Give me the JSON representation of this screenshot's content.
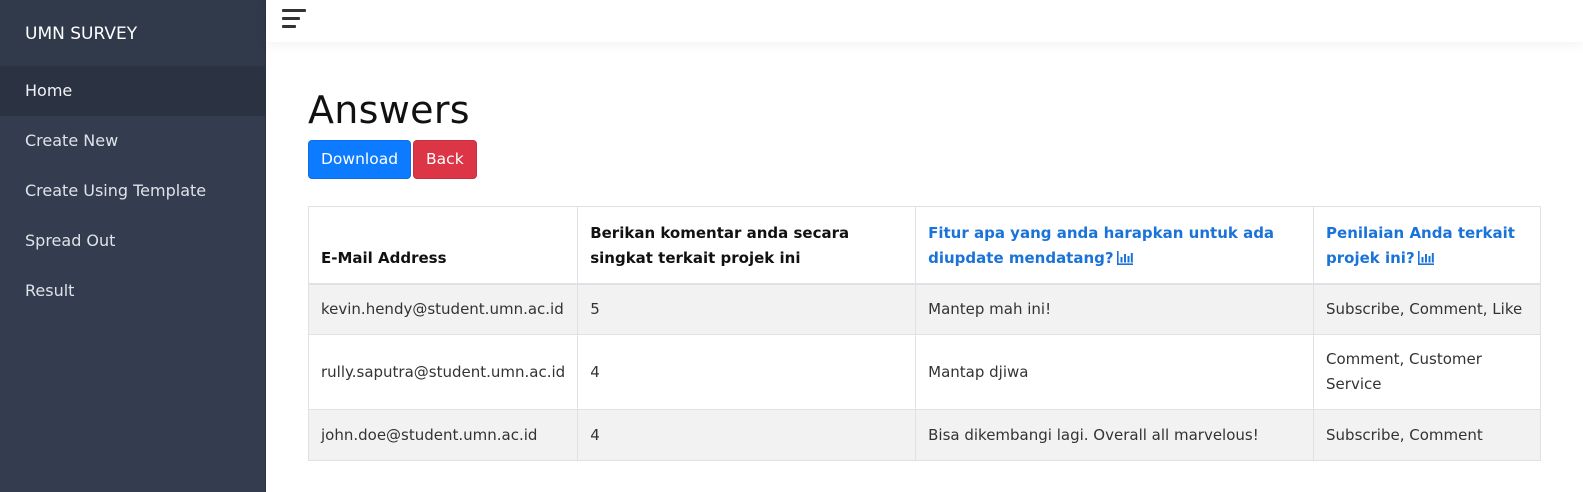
{
  "sidebar": {
    "brand": "UMN SURVEY",
    "items": [
      {
        "label": "Home",
        "active": true
      },
      {
        "label": "Create New"
      },
      {
        "label": "Create Using Template"
      },
      {
        "label": "Spread Out"
      },
      {
        "label": "Result"
      }
    ]
  },
  "topbar": {
    "menu_icon": "hamburger-menu-icon"
  },
  "main": {
    "title": "Answers",
    "download_label": "Download",
    "back_label": "Back"
  },
  "table": {
    "headers": [
      {
        "label": "E-Mail Address",
        "link": false
      },
      {
        "label": "Berikan komentar anda secara singkat terkait projek ini",
        "link": false
      },
      {
        "label": "Fitur apa yang anda harapkan untuk ada diupdate mendatang?",
        "link": true,
        "icon": "bar-chart-icon"
      },
      {
        "label": "Penilaian Anda terkait projek ini?",
        "link": true,
        "icon": "bar-chart-icon"
      }
    ],
    "rows": [
      [
        "kevin.hendy@student.umn.ac.id",
        "5",
        "Mantep mah ini!",
        "Subscribe, Comment, Like"
      ],
      [
        "rully.saputra@student.umn.ac.id",
        "4",
        "Mantap djiwa",
        "Comment, Customer Service"
      ],
      [
        "john.doe@student.umn.ac.id",
        "4",
        "Bisa dikembangi lagi. Overall all marvelous!",
        "Subscribe, Comment"
      ]
    ]
  },
  "colors": {
    "sidebar_bg": "#343d4f",
    "primary": "#0d7bff",
    "danger": "#dc3545",
    "link": "#1a73d8"
  }
}
